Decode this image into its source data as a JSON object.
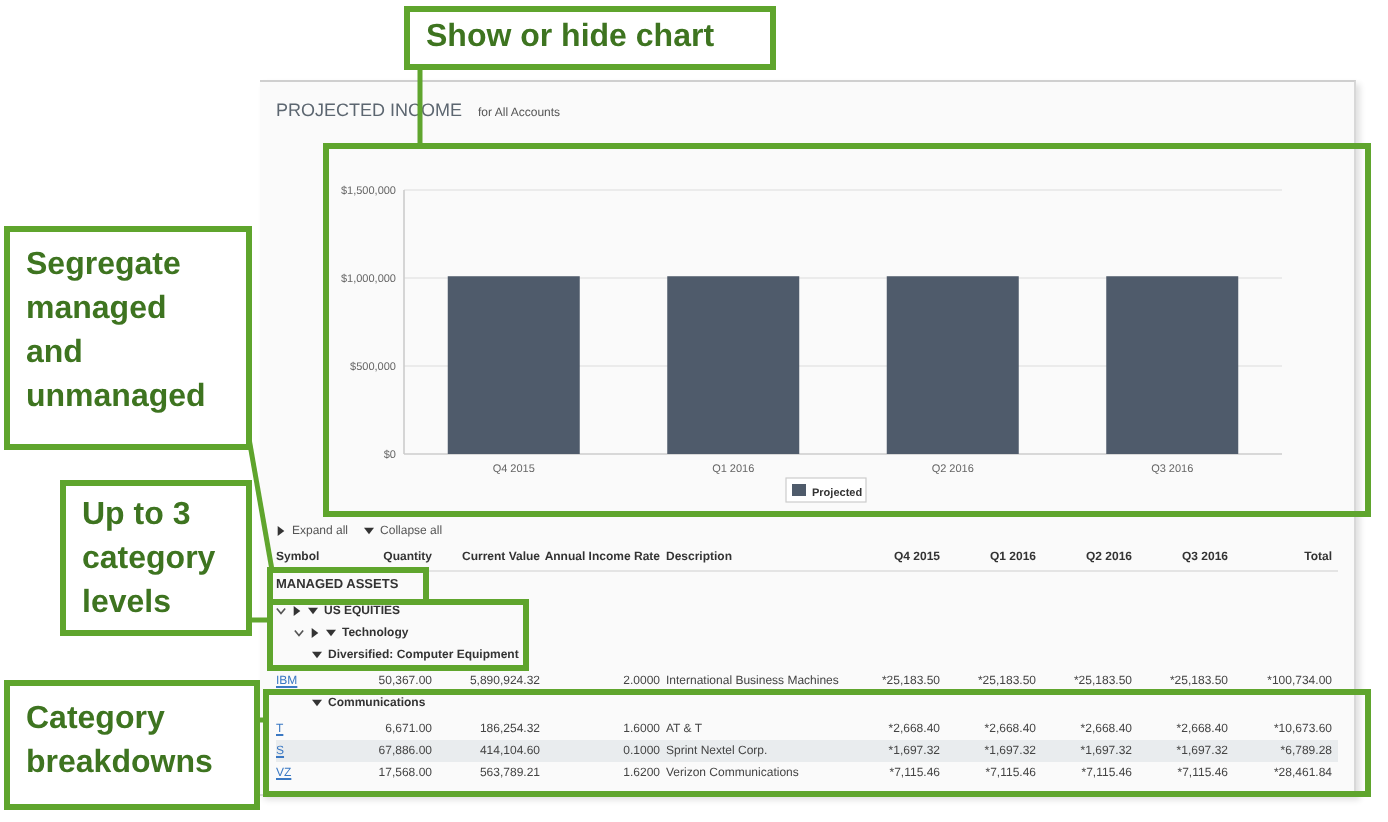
{
  "panel": {
    "title": "PROJECTED INCOME",
    "subtitle": "for All Accounts"
  },
  "chart": {
    "chart_data": {
      "type": "bar",
      "categories": [
        "Q4 2015",
        "Q1 2016",
        "Q2 2016",
        "Q3 2016"
      ],
      "series": [
        {
          "name": "Projected",
          "color": "#4f5b6b",
          "values": [
            1010000,
            1010000,
            1010000,
            1010000
          ]
        }
      ],
      "ylim": [
        0,
        1500000
      ],
      "yticks": [
        {
          "value": 0,
          "label": "$0"
        },
        {
          "value": 500000,
          "label": "$500,000"
        },
        {
          "value": 1000000,
          "label": "$1,000,000"
        },
        {
          "value": 1500000,
          "label": "$1,500,000"
        }
      ]
    }
  },
  "toolbar": {
    "expand_all": "Expand all",
    "collapse_all": "Collapse all"
  },
  "table": {
    "columns": [
      "Symbol",
      "Quantity",
      "Current Value",
      "Annual Income Rate",
      "Description",
      "Q4 2015",
      "Q1 2016",
      "Q2 2016",
      "Q3 2016",
      "Total"
    ],
    "groups": [
      {
        "label": "MANAGED ASSETS",
        "children": [
          {
            "label": "US EQUITIES",
            "expanded": true,
            "children": [
              {
                "label": "Technology",
                "expanded": true,
                "children": [
                  {
                    "label": "Diversified: Computer Equipment",
                    "expanded": true,
                    "rows": [
                      {
                        "selected": false,
                        "cells": [
                          "IBM",
                          "50,367.00",
                          "5,890,924.32",
                          "2.0000",
                          "International Business Machines",
                          "*25,183.50",
                          "*25,183.50",
                          "*25,183.50",
                          "*25,183.50",
                          "*100,734.00"
                        ]
                      }
                    ]
                  },
                  {
                    "label": "Communications",
                    "expanded": true,
                    "rows": [
                      {
                        "selected": false,
                        "cells": [
                          "T",
                          "6,671.00",
                          "186,254.32",
                          "1.6000",
                          "AT & T",
                          "*2,668.40",
                          "*2,668.40",
                          "*2,668.40",
                          "*2,668.40",
                          "*10,673.60"
                        ]
                      },
                      {
                        "selected": true,
                        "cells": [
                          "S",
                          "67,886.00",
                          "414,104.60",
                          "0.1000",
                          "Sprint Nextel Corp.",
                          "*1,697.32",
                          "*1,697.32",
                          "*1,697.32",
                          "*1,697.32",
                          "*6,789.28"
                        ]
                      },
                      {
                        "selected": false,
                        "cells": [
                          "VZ",
                          "17,568.00",
                          "563,789.21",
                          "1.6200",
                          "Verizon Communications",
                          "*7,115.46",
                          "*7,115.46",
                          "*7,115.46",
                          "*7,115.46",
                          "*28,461.84"
                        ]
                      }
                    ]
                  }
                ]
              }
            ]
          }
        ]
      }
    ]
  },
  "callouts": [
    {
      "text": "Show or hide chart"
    },
    {
      "text": "Segregate managed and unmanaged"
    },
    {
      "text": "Up to 3 category levels"
    },
    {
      "text": "Category breakdowns"
    }
  ]
}
